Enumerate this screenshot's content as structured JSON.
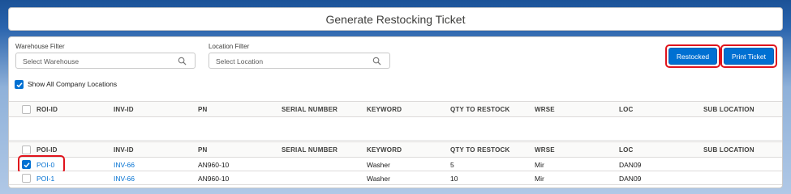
{
  "header": {
    "title": "Generate Restocking Ticket"
  },
  "filters": {
    "warehouse": {
      "label": "Warehouse Filter",
      "placeholder": "Select Warehouse"
    },
    "location": {
      "label": "Location Filter",
      "placeholder": "Select Location"
    }
  },
  "actions": {
    "restocked_label": "Restocked",
    "print_label": "Print Ticket"
  },
  "show_all": {
    "label": "Show All Company Locations",
    "checked": true
  },
  "roi_table": {
    "columns": [
      "ROI-ID",
      "INV-ID",
      "PN",
      "SERIAL NUMBER",
      "KEYWORD",
      "QTY TO RESTOCK",
      "WRSE",
      "LOC",
      "SUB LOCATION"
    ],
    "rows": []
  },
  "poi_table": {
    "columns": [
      "POI-ID",
      "INV-ID",
      "PN",
      "SERIAL NUMBER",
      "KEYWORD",
      "QTY TO RESTOCK",
      "WRSE",
      "LOC",
      "SUB LOCATION"
    ],
    "rows": [
      {
        "poi_id": "POI-0",
        "inv_id": "INV-66",
        "pn": "AN960-10",
        "serial": "",
        "keyword": "Washer",
        "qty": "5",
        "wrse": "Mir",
        "loc": "DAN09",
        "sub": "",
        "checked": true
      },
      {
        "poi_id": "POI-1",
        "inv_id": "INV-66",
        "pn": "AN960-10",
        "serial": "",
        "keyword": "Washer",
        "qty": "10",
        "wrse": "Mir",
        "loc": "DAN09",
        "sub": "",
        "checked": false
      }
    ]
  },
  "colors": {
    "accent": "#0070d2",
    "highlight": "#e0131c"
  }
}
